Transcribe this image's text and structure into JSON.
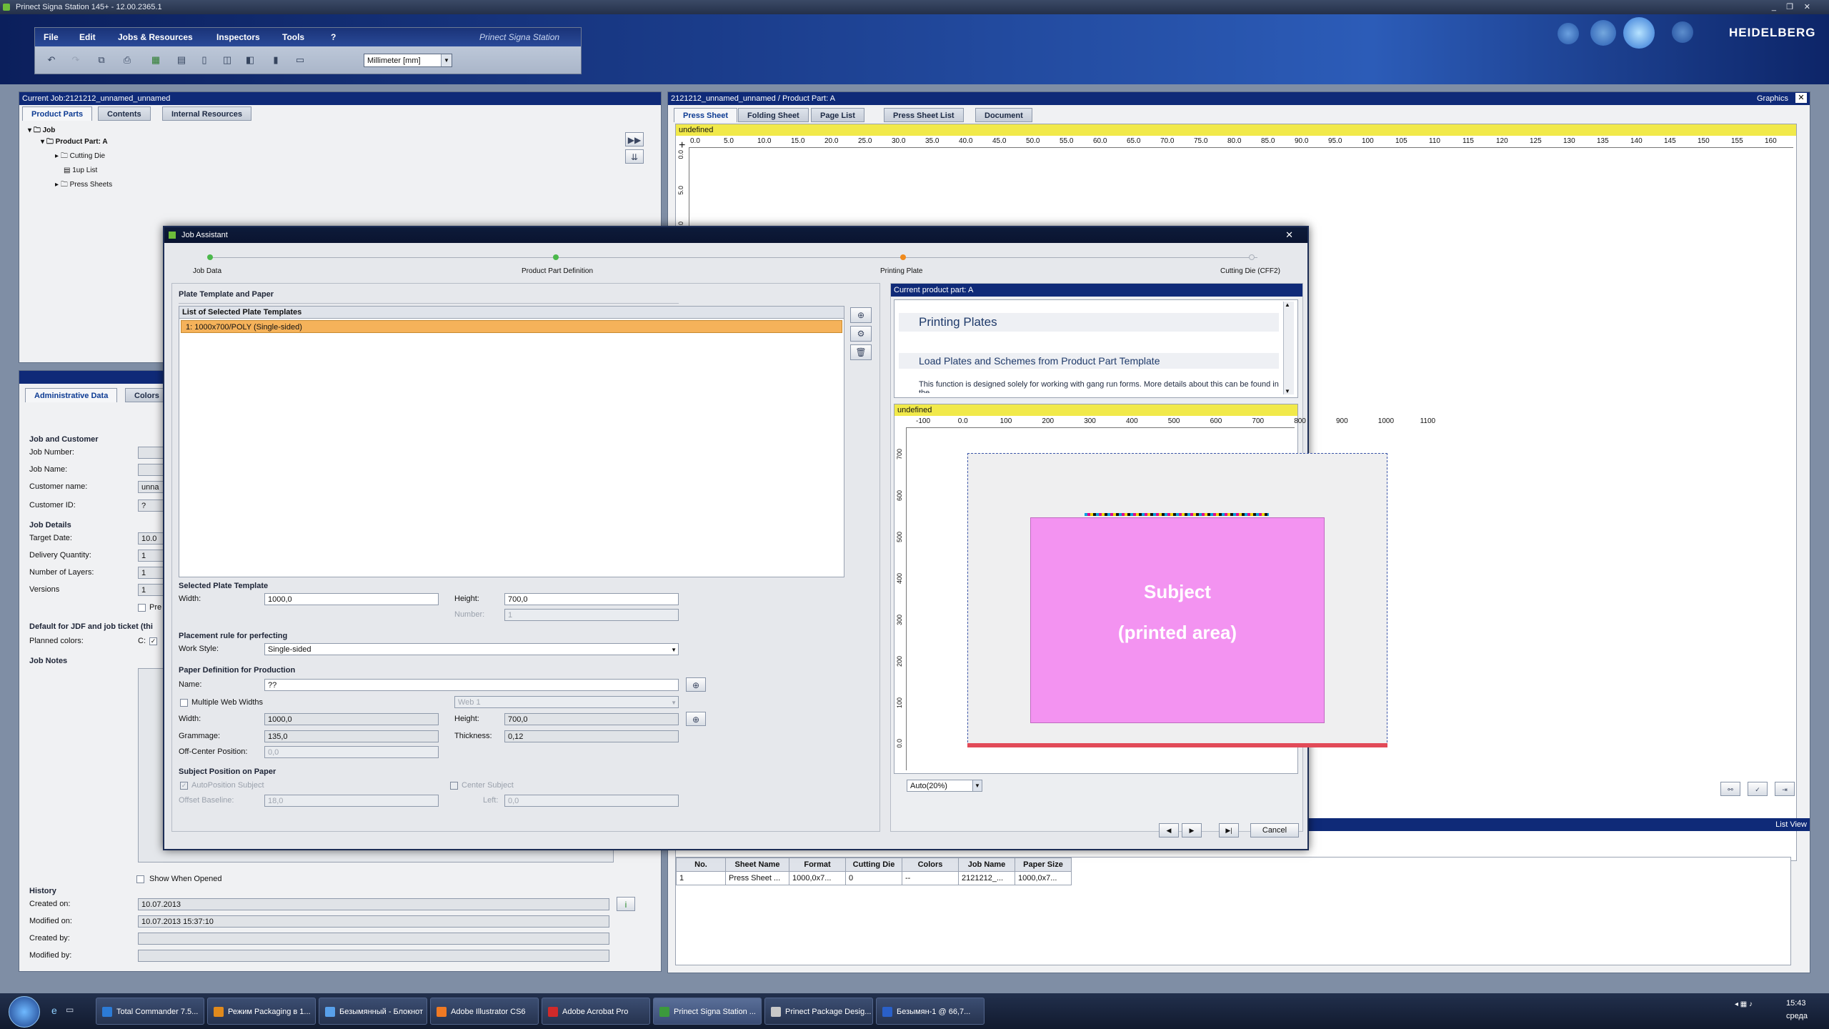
{
  "window": {
    "title": "Prinect Signa Station 145+ - 12.00.2365.1",
    "controls": [
      "_",
      "❐",
      "✕"
    ]
  },
  "brand": {
    "logo": "HEIDELBERG",
    "app_caption": "Prinect Signa Station"
  },
  "menu": {
    "items": [
      "File",
      "Edit",
      "Jobs & Resources",
      "Inspectors",
      "Tools",
      "?"
    ]
  },
  "toolbar": {
    "units": "Millimeter [mm]",
    "icons": [
      "undo-icon",
      "redo-icon",
      "copy-icon",
      "print-icon",
      "sheet-icon",
      "layout-icon",
      "page-icon",
      "fold-icon",
      "mark-icon",
      "plate-icon",
      "doc-icon"
    ]
  },
  "left_panel": {
    "header": "Current Job:2121212_unnamed_unnamed",
    "tabs": [
      "Product Parts",
      "Contents",
      "Internal Resources"
    ],
    "tree": {
      "job": "Job",
      "product_part": "Product Part: A",
      "children": [
        "Cutting Die",
        "1up List",
        "Press Sheets"
      ]
    }
  },
  "admin_panel": {
    "tabs": [
      "Administrative Data",
      "Colors"
    ],
    "job_and_customer": "Job and Customer",
    "labels": {
      "job_number": "Job Number:",
      "job_name": "Job Name:",
      "customer_name": "Customer name:",
      "customer_id": "Customer ID:"
    },
    "values": {
      "customer_name": "unna",
      "customer_id": "?"
    },
    "job_details": "Job Details",
    "detail_labels": {
      "target_date": "Target Date:",
      "delivery_quantity": "Delivery Quantity:",
      "layers": "Number of Layers:",
      "versions": "Versions"
    },
    "detail_values": {
      "target_date": "10.0",
      "delivery_quantity": "1",
      "layers": "1",
      "versions": "1"
    },
    "pre_checkbox": "Pre",
    "default_jdf": "Default for JDF and job ticket (thi",
    "planned_colors": "Planned colors:",
    "planned_colors_value": "C:",
    "job_notes": "Job Notes",
    "show_when_opened": "Show When Opened",
    "history": "History",
    "history_labels": {
      "created_on": "Created on:",
      "modified_on": "Modified on:",
      "created_by": "Created by:",
      "modified_by": "Modified by:"
    },
    "history_values": {
      "created_on": "10.07.2013",
      "modified_on": "10.07.2013   15:37:10",
      "created_by": "",
      "modified_by": ""
    }
  },
  "right_panel": {
    "header": "2121212_unnamed_unnamed / Product Part: A",
    "graphics_label": "Graphics",
    "tabs": [
      "Press Sheet",
      "Folding Sheet",
      "Page List",
      "Press Sheet List",
      "Document"
    ],
    "status": "undefined",
    "ruler_x": [
      "0.0",
      "5.0",
      "10.0",
      "15.0",
      "20.0",
      "25.0",
      "30.0",
      "35.0",
      "40.0",
      "45.0",
      "50.0",
      "55.0",
      "60.0",
      "65.0",
      "70.0",
      "75.0",
      "80.0",
      "85.0",
      "90.0",
      "95.0",
      "100",
      "105",
      "110",
      "115",
      "120",
      "125",
      "130",
      "135",
      "140",
      "145",
      "150",
      "155",
      "160"
    ],
    "ruler_y": [
      "0.0",
      "5.0",
      "10.0"
    ],
    "list_view": "List View",
    "table": {
      "headers": [
        "No.",
        "Sheet Name",
        "Format",
        "Cutting Die",
        "Colors",
        "Job Name",
        "Paper Size"
      ],
      "rows": [
        [
          "1",
          "Press Sheet ...",
          "1000,0x7...",
          "0",
          "--",
          "2121212_...",
          "1000,0x7..."
        ]
      ]
    }
  },
  "dialog": {
    "title": "Job Assistant",
    "steps": [
      {
        "label": "Job Data",
        "state": "done"
      },
      {
        "label": "Product Part Definition",
        "state": "done"
      },
      {
        "label": "Printing Plate",
        "state": "current"
      },
      {
        "label": "Cutting Die (CFF2)",
        "state": "todo"
      }
    ],
    "plate_group": "Plate Template and Paper",
    "list_header": "List of Selected Plate Templates",
    "list_items": [
      "1: 1000x700/POLY (Single-sided)"
    ],
    "selected_template": "Selected Plate Template",
    "width_label": "Width:",
    "height_label": "Height:",
    "number_label": "Number:",
    "sel_width": "1000,0",
    "sel_height": "700,0",
    "sel_number": "1",
    "placement": "Placement rule for perfecting",
    "work_style_label": "Work Style:",
    "work_style": "Single-sided",
    "paper_def": "Paper Definition for Production",
    "name_label": "Name:",
    "paper_name": "??",
    "multi_web": "Multiple Web Widths",
    "web_value": "Web 1",
    "paper_width": "1000,0",
    "paper_height": "700,0",
    "grammage_label": "Grammage:",
    "grammage": "135,0",
    "thickness_label": "Thickness:",
    "thickness": "0,12",
    "offcenter_label": "Off-Center Position:",
    "offcenter": "0,0",
    "subject_pos": "Subject Position on Paper",
    "autoposition": "AutoPosition Subject",
    "center_subject": "Center Subject",
    "offset_label": "Offset Baseline:",
    "offset": "18,0",
    "left_label": "Left:",
    "left": "0,0",
    "current_part": "Current product part: A",
    "help_title": "Printing Plates",
    "help_subtitle": "Load Plates and Schemes from Product Part Template",
    "help_text": "This function is designed solely for working with gang run forms. More details about this can be found in the",
    "preview_status": "undefined",
    "preview_ruler_x": [
      "-100",
      "0.0",
      "100",
      "200",
      "300",
      "400",
      "500",
      "600",
      "700",
      "800",
      "900",
      "1000",
      "1100"
    ],
    "preview_ruler_y": [
      "700",
      "600",
      "500",
      "400",
      "300",
      "200",
      "100",
      "0.0"
    ],
    "subject_line1": "Subject",
    "subject_line2": "(printed area)",
    "zoom": "Auto(20%)",
    "cancel": "Cancel",
    "colors": {
      "subject": "#f393f1",
      "selection": "#f5b25a",
      "accent": "#0f2a78",
      "status_bar": "#f1e94a"
    }
  },
  "taskbar": {
    "items": [
      "Total Commander 7.5...",
      "Режим Packaging в 1...",
      "Безымянный - Блокнот",
      "Adobe Illustrator CS6",
      "Adobe Acrobat Pro",
      "Prinect Signa Station ...",
      "Prinect Package Desig...",
      "Безымян-1 @ 66,7..."
    ],
    "clock": "15:43",
    "day": "среда"
  }
}
